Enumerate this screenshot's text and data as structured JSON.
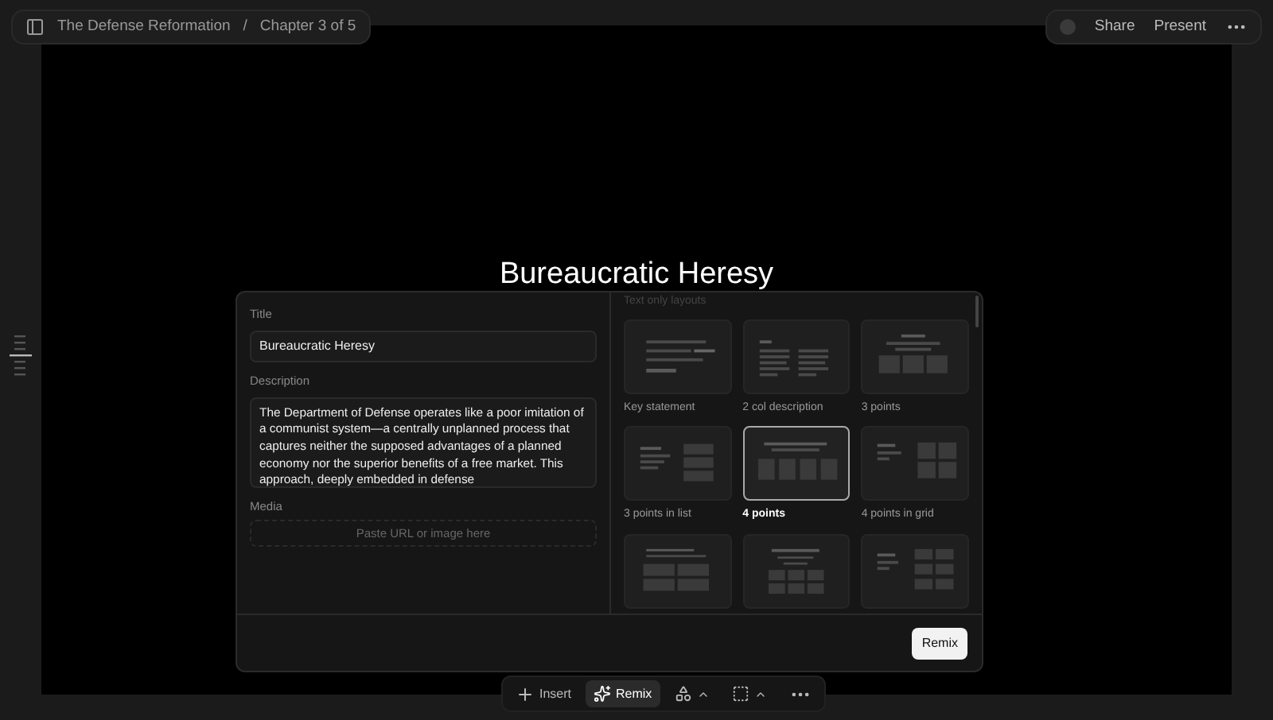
{
  "breadcrumb": {
    "document": "The Defense Reformation",
    "separator": "/",
    "chapter": "Chapter 3 of 5"
  },
  "header_actions": [
    "Share",
    "Present"
  ],
  "slide": {
    "title": "Bureaucratic Heresy"
  },
  "editor": {
    "title_label": "Title",
    "title_value": "Bureaucratic Heresy",
    "description_label": "Description",
    "description_value": "The Department of Defense operates like a poor imitation of a communist system—a centrally unplanned process that captures neither the supposed advantages of a planned economy nor the superior benefits of a free market. This approach, deeply embedded in defense",
    "media_label": "Media",
    "media_placeholder": "Paste URL or image here"
  },
  "layouts": {
    "heading": "Text only layouts",
    "items": [
      {
        "kind": "key-statement",
        "label": "Key statement",
        "selected": false
      },
      {
        "kind": "two-col",
        "label": "2 col description",
        "selected": false
      },
      {
        "kind": "three-points",
        "label": "3 points",
        "selected": false
      },
      {
        "kind": "points-list",
        "label": "3 points in list",
        "selected": false
      },
      {
        "kind": "four-points",
        "label": "4 points",
        "selected": true
      },
      {
        "kind": "points-grid",
        "label": "4 points in grid",
        "selected": false
      },
      {
        "kind": "two-by-two",
        "selected": false
      },
      {
        "kind": "three-by-two",
        "selected": false
      },
      {
        "kind": "list-grid",
        "selected": false
      }
    ]
  },
  "remix_button": "Remix",
  "toolbar": [
    {
      "kind": "insert",
      "label": "Insert",
      "selected": false
    },
    {
      "kind": "remix",
      "label": "Remix",
      "selected": true
    },
    {
      "kind": "chart",
      "selected": false
    },
    {
      "kind": "frame",
      "selected": false
    },
    {
      "kind": "more",
      "selected": false
    }
  ]
}
